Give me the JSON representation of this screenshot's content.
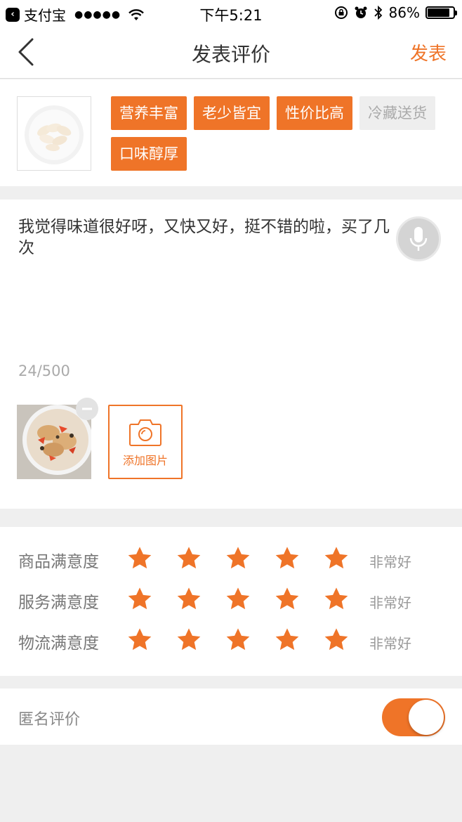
{
  "status_bar": {
    "back_app_label": "支付宝",
    "time": "下午5:21",
    "battery": "86%",
    "battery_level": 0.86
  },
  "nav": {
    "title": "发表评价",
    "action": "发表"
  },
  "product": {
    "tags": [
      {
        "label": "营养丰富",
        "selected": true
      },
      {
        "label": "老少皆宜",
        "selected": true
      },
      {
        "label": "性价比高",
        "selected": true
      },
      {
        "label": "冷藏送货",
        "selected": false
      },
      {
        "label": "口味醇厚",
        "selected": true
      }
    ]
  },
  "comment": {
    "text": "我觉得味道很好呀，又快又好，挺不错的啦，买了几次",
    "counter": "24/500",
    "add_photo_label": "添加图片"
  },
  "ratings": [
    {
      "label": "商品满意度",
      "stars": 5,
      "value": "非常好"
    },
    {
      "label": "服务满意度",
      "stars": 5,
      "value": "非常好"
    },
    {
      "label": "物流满意度",
      "stars": 5,
      "value": "非常好"
    }
  ],
  "anonymous": {
    "label": "匿名评价",
    "enabled": true
  },
  "colors": {
    "accent": "#ef7428",
    "background": "#efefef"
  }
}
